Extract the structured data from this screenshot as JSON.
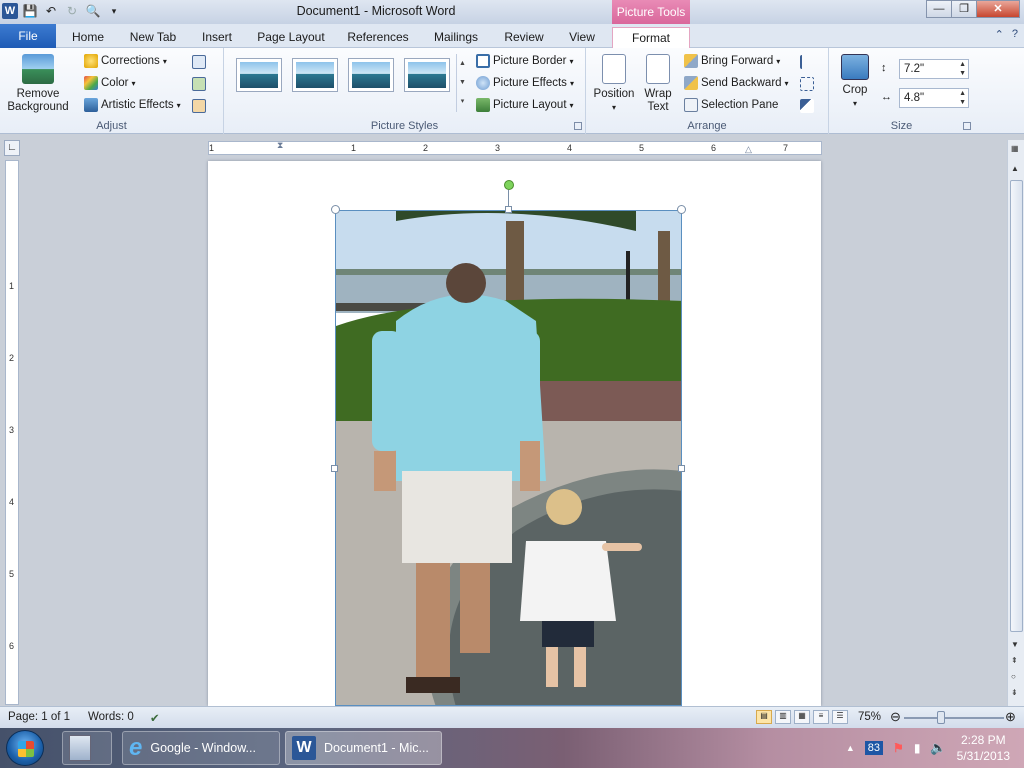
{
  "window": {
    "title": "Document1  -  Microsoft Word",
    "contextual_tab_header": "Picture Tools",
    "controls": {
      "minimize": "—",
      "restore": "❐",
      "close": "✕"
    }
  },
  "tabs": [
    "File",
    "Home",
    "New Tab",
    "Insert",
    "Page Layout",
    "References",
    "Mailings",
    "Review",
    "View",
    "Format"
  ],
  "ribbon": {
    "adjust": {
      "label": "Adjust",
      "remove_background": "Remove\nBackground",
      "corrections": "Corrections",
      "color": "Color",
      "artistic_effects": "Artistic Effects"
    },
    "picture_styles": {
      "label": "Picture Styles",
      "picture_border": "Picture Border",
      "picture_effects": "Picture Effects",
      "picture_layout": "Picture Layout"
    },
    "arrange": {
      "label": "Arrange",
      "position": "Position",
      "wrap_text": "Wrap\nText",
      "bring_forward": "Bring Forward",
      "send_backward": "Send Backward",
      "selection_pane": "Selection Pane"
    },
    "size": {
      "label": "Size",
      "crop": "Crop",
      "height": "7.2\"",
      "width": "4.8\""
    }
  },
  "ruler": {
    "h_numbers": [
      "1",
      "1",
      "2",
      "3",
      "4",
      "5",
      "6",
      "7"
    ],
    "v_numbers": [
      "1",
      "2",
      "3",
      "4",
      "5",
      "6"
    ]
  },
  "status": {
    "page": "Page: 1 of 1",
    "words": "Words: 0",
    "zoom": "75%"
  },
  "taskbar": {
    "items": [
      "Google - Window...",
      "Document1 - Mic..."
    ],
    "tray_badge": "83",
    "time": "2:28 PM",
    "date": "5/31/2013"
  },
  "colors": {
    "accent": "#2b5797",
    "contextual": "#d9679b",
    "file_tab": "#1f5bb5"
  }
}
